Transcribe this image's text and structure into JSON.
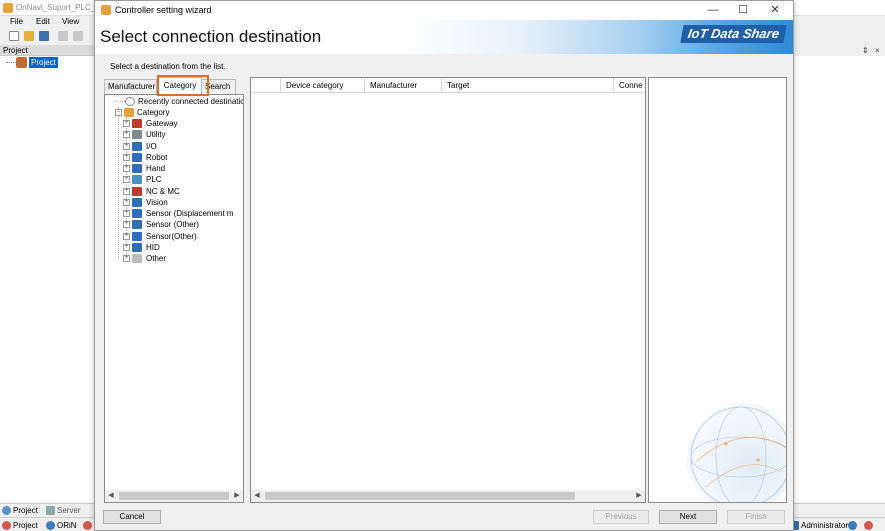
{
  "app": {
    "title": "OnNavi_Suport_PLC_J",
    "menu": [
      "File",
      "Edit",
      "View"
    ],
    "project_panel": {
      "header": "Project",
      "root_item": "Project"
    },
    "bottom_tabs": [
      "Project",
      "Server"
    ],
    "status_items": [
      "Project",
      "ORiN",
      "Administrator"
    ],
    "pin_glyph": "⇕",
    "close_glyph": "×"
  },
  "wizard": {
    "title": "Controller setting wizard",
    "header_title": "Select connection destination",
    "brand": "IoT Data Share",
    "instruction": "Select a destination from the list.",
    "tabs": [
      {
        "label": "Manufacturer",
        "active": false
      },
      {
        "label": "Category",
        "active": true
      },
      {
        "label": "Search",
        "active": false
      }
    ],
    "tree": {
      "recent": "Recently connected destination",
      "root": "Category",
      "children": [
        {
          "label": "Gateway",
          "icon_color": "#c0392b"
        },
        {
          "label": "Utility",
          "icon_color": "#7f8c8d"
        },
        {
          "label": "I/O",
          "icon_color": "#2c6fb7"
        },
        {
          "label": "Robot",
          "icon_color": "#2c6fb7"
        },
        {
          "label": "Hand",
          "icon_color": "#2c6fb7"
        },
        {
          "label": "PLC",
          "icon_color": "#4a90c8"
        },
        {
          "label": "NC & MC",
          "icon_color": "#c0392b"
        },
        {
          "label": "Vision",
          "icon_color": "#2c6fb7"
        },
        {
          "label": "Sensor (Displacement m",
          "icon_color": "#2c6fb7"
        },
        {
          "label": "Sensor (Other)",
          "icon_color": "#2c6fb7"
        },
        {
          "label": "Sensor(Other)",
          "icon_color": "#2c6fb7"
        },
        {
          "label": "HID",
          "icon_color": "#2c6fb7"
        },
        {
          "label": "Other",
          "icon_color": "#bdbdbd"
        }
      ]
    },
    "list_columns": [
      "",
      "Device category",
      "Manufacturer",
      "Target",
      "Conne"
    ],
    "buttons": {
      "cancel": "Cancel",
      "previous": "Previous",
      "next": "Next",
      "finish": "Finish"
    },
    "window_controls": {
      "minimize": "—",
      "maximize": "☐",
      "close": "✕"
    },
    "scroll_left": "◀",
    "scroll_right": "▶",
    "accent_color": "#e86a1e"
  }
}
